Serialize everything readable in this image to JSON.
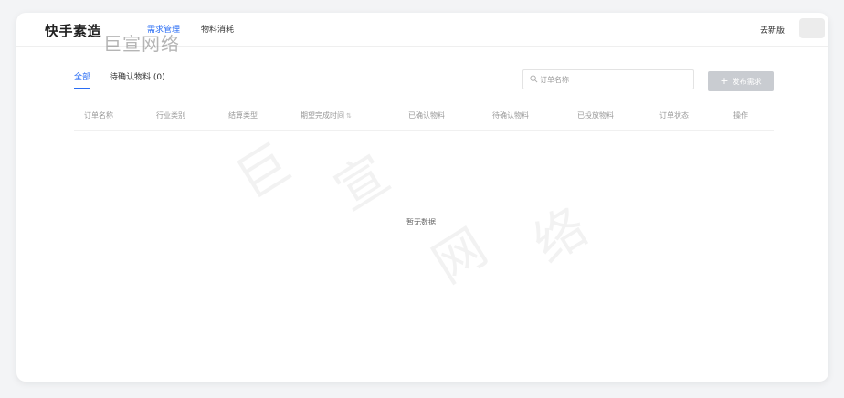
{
  "brand": {
    "title": "快手素造"
  },
  "nav": {
    "items": [
      {
        "label": "需求管理",
        "active": true
      },
      {
        "label": "物料消耗",
        "active": false
      }
    ],
    "switch_version": "去新版"
  },
  "tabs": [
    {
      "label": "全部",
      "active": true
    },
    {
      "label": "待确认物料 (0)",
      "active": false
    }
  ],
  "search": {
    "placeholder": "订单名称"
  },
  "publish_button": {
    "label": "发布需求"
  },
  "table": {
    "columns": [
      "订单名称",
      "行业类别",
      "结算类型",
      "期望完成时间",
      "已确认物料",
      "待确认物料",
      "已投放物料",
      "订单状态",
      "操作"
    ]
  },
  "empty": {
    "text": "暂无数据"
  },
  "watermark": {
    "logo": "巨宣网络",
    "chars": [
      "巨",
      "宣",
      "网",
      "络"
    ]
  },
  "colors": {
    "accent": "#2a6df4",
    "disabled_button": "#c9ccd1"
  }
}
